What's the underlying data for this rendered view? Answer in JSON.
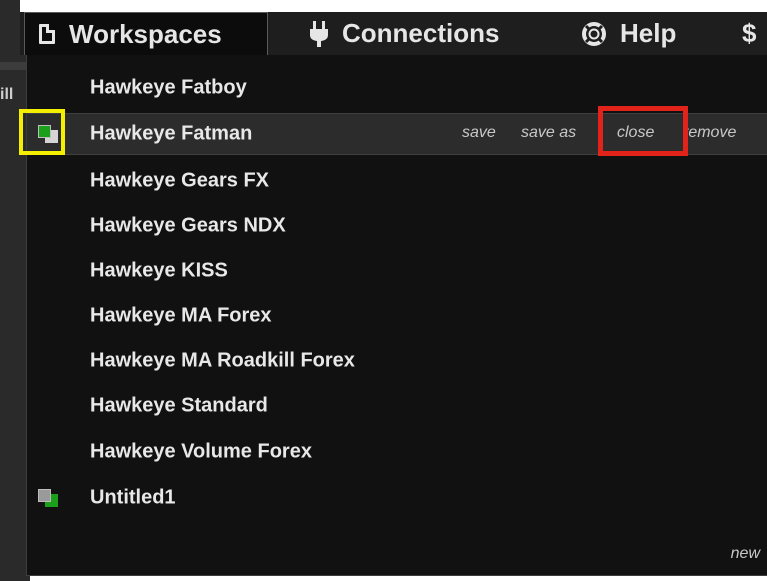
{
  "background": {
    "partial_text": "ill"
  },
  "menubar": {
    "tabs": [
      {
        "label": "Workspaces",
        "icon": "document-icon",
        "active": true
      },
      {
        "label": "Connections",
        "icon": "plug-icon"
      },
      {
        "label": "Help",
        "icon": "lifebuoy-icon"
      },
      {
        "label": "$",
        "icon": null
      }
    ]
  },
  "workspaces": {
    "items": [
      {
        "name": "Hawkeye Fatboy"
      },
      {
        "name": "Hawkeye Fatman",
        "open": true,
        "selected": true
      },
      {
        "name": "Hawkeye Gears FX"
      },
      {
        "name": "Hawkeye Gears NDX"
      },
      {
        "name": "Hawkeye KISS"
      },
      {
        "name": "Hawkeye MA Forex"
      },
      {
        "name": "Hawkeye MA Roadkill Forex"
      },
      {
        "name": "Hawkeye Standard"
      },
      {
        "name": "Hawkeye Volume Forex"
      },
      {
        "name": "Untitled1",
        "open": true
      }
    ],
    "row_actions": {
      "save": "save",
      "save_as": "save as",
      "close": "close",
      "remove": "remove"
    },
    "new_label": "new"
  },
  "colors": {
    "highlight_yellow": "#f4ee00",
    "highlight_red": "#e2231a",
    "active_green": "#1aa01a"
  }
}
